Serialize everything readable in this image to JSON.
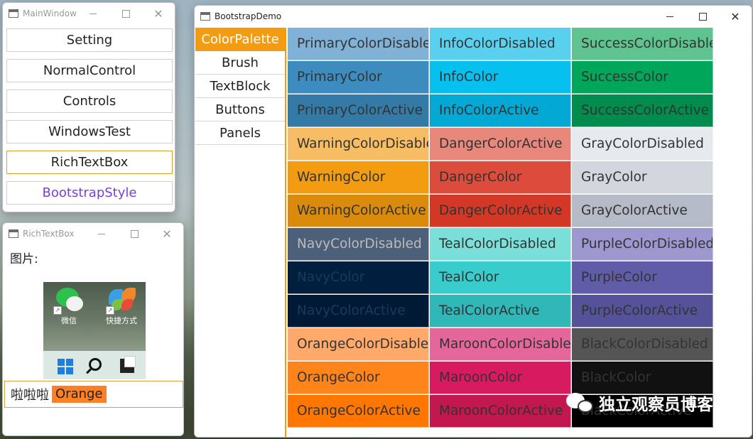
{
  "main_window": {
    "title": "MainWindow",
    "buttons": [
      {
        "label": "Setting"
      },
      {
        "label": "NormalControl"
      },
      {
        "label": "Controls"
      },
      {
        "label": "WindowsTest"
      },
      {
        "label": "RichTextBox"
      },
      {
        "label": "BootstrapStyle"
      }
    ]
  },
  "rtb_window": {
    "title": "RichTextBox",
    "image_label": "图片:",
    "icon_wechat": "微信",
    "icon_shortcut": "快捷方式",
    "line_text": "啦啦啦",
    "chip_text": "Orange",
    "chip_color": "#ff7f24"
  },
  "bs_window": {
    "title": "BootstrapDemo",
    "tabs": [
      "ColorPalette",
      "Brush",
      "TextBlock",
      "Buttons",
      "Panels"
    ],
    "active_tab": "ColorPalette",
    "accent": "#f39c12",
    "swatches": [
      [
        {
          "label": "PrimaryColorDisabled",
          "bg": "#7fb2d6",
          "fg": "#333333"
        },
        {
          "label": "InfoColorDisabled",
          "bg": "#5ad0ef",
          "fg": "#333333"
        },
        {
          "label": "SuccessColorDisabled",
          "bg": "#5ec38e",
          "fg": "#333333"
        }
      ],
      [
        {
          "label": "PrimaryColor",
          "bg": "#3d8cc0",
          "fg": "#333333"
        },
        {
          "label": "InfoColor",
          "bg": "#06c0ef",
          "fg": "#333333"
        },
        {
          "label": "SuccessColor",
          "bg": "#00a65a",
          "fg": "#333333"
        }
      ],
      [
        {
          "label": "PrimaryColorActive",
          "bg": "#347aa7",
          "fg": "#333333"
        },
        {
          "label": "InfoColorActive",
          "bg": "#01a9d4",
          "fg": "#333333"
        },
        {
          "label": "SuccessColorActive",
          "bg": "#008c4c",
          "fg": "#333333"
        }
      ],
      [
        {
          "label": "WarningColorDisabled",
          "bg": "#f7bd64",
          "fg": "#333333"
        },
        {
          "label": "DangerColorActive",
          "bg": "#e8877c",
          "fg": "#333333"
        },
        {
          "label": "GrayColorDisabled",
          "bg": "#e6e9ee",
          "fg": "#333333"
        }
      ],
      [
        {
          "label": "WarningColor",
          "bg": "#f39c12",
          "fg": "#333333"
        },
        {
          "label": "DangerColor",
          "bg": "#dd4c3b",
          "fg": "#333333"
        },
        {
          "label": "GrayColor",
          "bg": "#d2d6dd",
          "fg": "#333333"
        }
      ],
      [
        {
          "label": "WarningColorActive",
          "bg": "#db8b0b",
          "fg": "#333333"
        },
        {
          "label": "DangerColorActive",
          "bg": "#d33725",
          "fg": "#333333"
        },
        {
          "label": "GrayColorActive",
          "bg": "#b4bac6",
          "fg": "#333333"
        }
      ],
      [
        {
          "label": "NavyColorDisabled",
          "bg": "#4c6179",
          "fg": "#bbbbbb"
        },
        {
          "label": "TealColorDisabled",
          "bg": "#79dfd8",
          "fg": "#333333"
        },
        {
          "label": "PurpleColorDisabled",
          "bg": "#9d97cf",
          "fg": "#333333"
        }
      ],
      [
        {
          "label": "NavyColor",
          "bg": "#001f3f",
          "fg": "#1a3a5c"
        },
        {
          "label": "TealColor",
          "bg": "#39cccc",
          "fg": "#333333"
        },
        {
          "label": "PurpleColor",
          "bg": "#605ca8",
          "fg": "#333333"
        }
      ],
      [
        {
          "label": "NavyColorActive",
          "bg": "#001a35",
          "fg": "#1a3a5c"
        },
        {
          "label": "TealColorActive",
          "bg": "#30b7b7",
          "fg": "#333333"
        },
        {
          "label": "PurpleColorActive",
          "bg": "#555299",
          "fg": "#333333"
        }
      ],
      [
        {
          "label": "OrangeColorDisabled",
          "bg": "#ffaa6a",
          "fg": "#333333"
        },
        {
          "label": "MaroonColorDisabled",
          "bg": "#e4669b",
          "fg": "#333333"
        },
        {
          "label": "BlackColorDisabled",
          "bg": "#555555",
          "fg": "#333333"
        }
      ],
      [
        {
          "label": "OrangeColor",
          "bg": "#ff851b",
          "fg": "#333333"
        },
        {
          "label": "MaroonColor",
          "bg": "#d81b60",
          "fg": "#333333"
        },
        {
          "label": "BlackColor",
          "bg": "#111111",
          "fg": "#333333"
        }
      ],
      [
        {
          "label": "OrangeColorActive",
          "bg": "#ff7701",
          "fg": "#333333"
        },
        {
          "label": "MaroonColorActive",
          "bg": "#c3174f",
          "fg": "#333333"
        },
        {
          "label": "BlackColorActive",
          "bg": "#000000",
          "fg": "#333333"
        }
      ]
    ]
  },
  "watermark_text": "独立观察员博客"
}
